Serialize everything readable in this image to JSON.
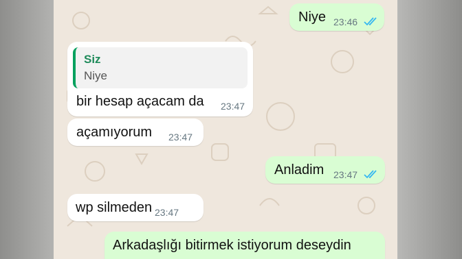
{
  "colors": {
    "chat_background": "#efe7dd",
    "incoming_bubble": "#ffffff",
    "outgoing_bubble": "#d9fdd3",
    "quote_bar": "#06a15e",
    "read_ticks": "#34b7f1"
  },
  "messages": [
    {
      "direction": "outgoing",
      "text": "Niye",
      "time": "23:46",
      "status_icon": "double-check-read-icon"
    },
    {
      "direction": "incoming",
      "quote": {
        "author": "Siz",
        "text": "Niye"
      },
      "text": "bir hesap açacam da",
      "time": "23:47"
    },
    {
      "direction": "incoming",
      "text": "açamıyorum",
      "time": "23:47"
    },
    {
      "direction": "outgoing",
      "text": "Anladim",
      "time": "23:47",
      "status_icon": "double-check-read-icon"
    },
    {
      "direction": "incoming",
      "text": "wp silmeden",
      "time": "23:47"
    },
    {
      "direction": "outgoing",
      "text": "Arkadaşlığı bitirmek istiyorum deseydin"
    }
  ]
}
